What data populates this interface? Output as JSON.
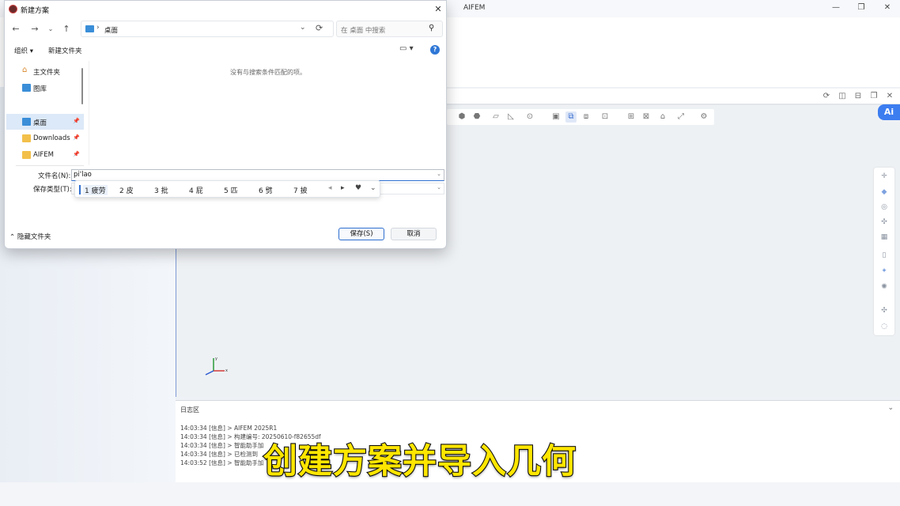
{
  "app": {
    "title": "AIFEM",
    "caption": "创建方案并导入几何",
    "log": {
      "title": "日志区",
      "lines": [
        "14:03:34 [信息] > AIFEM 2025R1",
        "14:03:34 [信息] > 构建编号: 20250610-f82655df",
        "14:03:34 [信息] > 智能助手加",
        "14:03:34 [信息] > 已检测到",
        "14:03:52 [信息] > 智能助手加"
      ]
    },
    "ai_badge": "Ai"
  },
  "dialog": {
    "title": "新建方案",
    "address": "桌面",
    "search_placeholder": "在 桌面 中搜索",
    "organize_label": "组织 ▾",
    "new_folder_label": "新建文件夹",
    "nav_items": [
      {
        "label": "主文件夹",
        "icon": "home-icon"
      },
      {
        "label": "图库",
        "icon": "gallery-icon"
      },
      {
        "label": "桌面",
        "icon": "desktop-icon",
        "pinned": true,
        "selected": true
      },
      {
        "label": "Downloads",
        "icon": "folder-icon",
        "pinned": true
      },
      {
        "label": "AIFEM",
        "icon": "folder-icon",
        "pinned": true
      }
    ],
    "empty_message": "没有与搜索条件匹配的项。",
    "filename_label": "文件名(N):",
    "filename_value": "pi'lao",
    "filetype_label": "保存类型(T):",
    "ime_candidates": [
      "1 疲劳",
      "2 皮",
      "3 批",
      "4 屁",
      "5 匹",
      "6 劈",
      "7 披"
    ],
    "hide_folders_label": "隐藏文件夹",
    "save_label": "保存(S)",
    "cancel_label": "取消"
  },
  "colors": {
    "accent": "#2f6fd0",
    "caption_fill": "#ffe600"
  }
}
